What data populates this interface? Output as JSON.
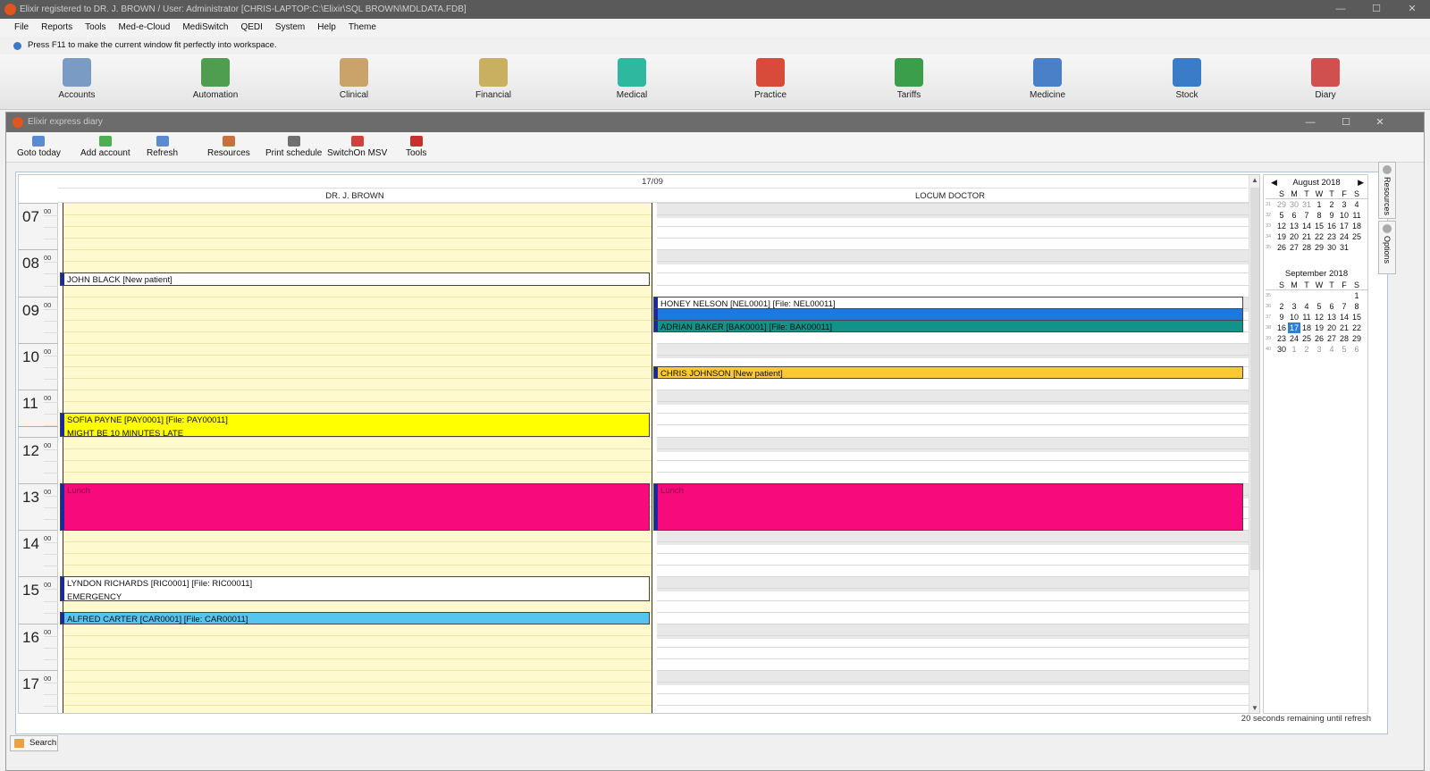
{
  "window": {
    "title": "Elixir registered to DR. J. BROWN / User: Administrator [CHRIS-LAPTOP:C:\\Elixir\\SQL BROWN\\MDLDATA.FDB]",
    "minimize": "—",
    "maximize": "☐",
    "close": "✕"
  },
  "menu": [
    "File",
    "Reports",
    "Tools",
    "Med-e-Cloud",
    "MediSwitch",
    "QEDI",
    "System",
    "Help",
    "Theme"
  ],
  "hint": "Press F11 to make the current window fit perfectly into workspace.",
  "modules": [
    {
      "label": "Accounts",
      "icon": "accounts-icon",
      "color": "#7a9cc4"
    },
    {
      "label": "Automation",
      "icon": "automation-icon",
      "color": "#4f9e4f"
    },
    {
      "label": "Clinical",
      "icon": "clinical-icon",
      "color": "#c9a36a"
    },
    {
      "label": "Financial",
      "icon": "financial-icon",
      "color": "#c9b060"
    },
    {
      "label": "Medical",
      "icon": "medical-icon",
      "color": "#2fb8a0"
    },
    {
      "label": "Practice",
      "icon": "practice-icon",
      "color": "#d84a3a"
    },
    {
      "label": "Tariffs",
      "icon": "tariffs-icon",
      "color": "#3a9e4a"
    },
    {
      "label": "Medicine",
      "icon": "medicine-icon",
      "color": "#4a80c8"
    },
    {
      "label": "Stock",
      "icon": "stock-icon",
      "color": "#3a7cc8"
    },
    {
      "label": "Diary",
      "icon": "diary-icon",
      "color": "#d05050"
    }
  ],
  "diary": {
    "title": "Elixir express diary",
    "toolbar": [
      {
        "label": "Goto today",
        "icon": "calendar-icon",
        "color": "#5a8ad0"
      },
      {
        "label": "Add account",
        "icon": "add-icon",
        "color": "#4caf50"
      },
      {
        "label": "Refresh",
        "icon": "refresh-icon",
        "color": "#5a8ad0"
      },
      {
        "label": "Resources",
        "icon": "resources-icon",
        "color": "#c87040"
      },
      {
        "label": "Print schedule",
        "icon": "printer-icon",
        "color": "#707070"
      },
      {
        "label": "SwitchOn MSV",
        "icon": "switch-icon",
        "color": "#d04040"
      },
      {
        "label": "Tools",
        "icon": "toolbox-icon",
        "color": "#c83030"
      }
    ],
    "date": "17/09",
    "columns": [
      "DR. J. BROWN",
      "LOCUM DOCTOR"
    ],
    "hours": [
      "07",
      "08",
      "09",
      "10",
      "11",
      "12",
      "13",
      "14",
      "15",
      "16",
      "17"
    ],
    "minutes_label": "00",
    "appointments_col1": [
      {
        "text": "JOHN BLACK [New patient]",
        "note": "",
        "start": "08:30",
        "end": "08:45",
        "color": "#ffffff"
      },
      {
        "text": "SOFIA PAYNE [PAY0001] [File: PAY00011]",
        "note": "MIGHT BE 10 MINUTES LATE",
        "start": "11:30",
        "end": "12:00",
        "color": "#ffff00"
      },
      {
        "text": "Lunch",
        "note": "",
        "start": "13:00",
        "end": "14:00",
        "color": "#f70b7c"
      },
      {
        "text": "LYNDON RICHARDS [RIC0001] [File: RIC00011]",
        "note": "EMERGENCY",
        "start": "15:00",
        "end": "15:30",
        "color": "#ffffff"
      },
      {
        "text": "ALFRED CARTER [CAR0001] [File: CAR00011]",
        "note": "",
        "start": "15:45",
        "end": "16:00",
        "color": "#58c4f0"
      }
    ],
    "appointments_col2": [
      {
        "text": "HONEY NELSON [NEL0001] [File: NEL00011]",
        "note": "",
        "start": "09:00",
        "end": "09:15",
        "color": "#ffffff"
      },
      {
        "text": "",
        "note": "",
        "start": "09:15",
        "end": "09:30",
        "color": "#1e78e0"
      },
      {
        "text": "ADRIAN BAKER [BAK0001] [File: BAK00011]",
        "note": "",
        "start": "09:30",
        "end": "09:45",
        "color": "#11938a"
      },
      {
        "text": "CHRIS JOHNSON [New patient]",
        "note": "",
        "start": "10:30",
        "end": "10:45",
        "color": "#fcc838"
      },
      {
        "text": "Lunch",
        "note": "",
        "start": "13:00",
        "end": "14:00",
        "color": "#f70b7c"
      }
    ],
    "refresh_msg": "20 seconds remaining until refresh",
    "side_tabs": [
      "Resources",
      "Options"
    ],
    "search": "Search"
  },
  "calendars": [
    {
      "month": "August 2018",
      "days_header": [
        "S",
        "M",
        "T",
        "W",
        "T",
        "F",
        "S"
      ],
      "weeks": [
        {
          "wk": "31",
          "days": [
            "29",
            "30",
            "31",
            "1",
            "2",
            "3",
            "4"
          ],
          "dim": [
            0,
            1,
            2
          ]
        },
        {
          "wk": "32",
          "days": [
            "5",
            "6",
            "7",
            "8",
            "9",
            "10",
            "11"
          ],
          "dim": []
        },
        {
          "wk": "33",
          "days": [
            "12",
            "13",
            "14",
            "15",
            "16",
            "17",
            "18"
          ],
          "dim": []
        },
        {
          "wk": "34",
          "days": [
            "19",
            "20",
            "21",
            "22",
            "23",
            "24",
            "25"
          ],
          "dim": []
        },
        {
          "wk": "35",
          "days": [
            "26",
            "27",
            "28",
            "29",
            "30",
            "31",
            ""
          ],
          "dim": []
        }
      ]
    },
    {
      "month": "September 2018",
      "days_header": [
        "S",
        "M",
        "T",
        "W",
        "T",
        "F",
        "S"
      ],
      "weeks": [
        {
          "wk": "35",
          "days": [
            "",
            "",
            "",
            "",
            "",
            "",
            "1"
          ],
          "dim": []
        },
        {
          "wk": "36",
          "days": [
            "2",
            "3",
            "4",
            "5",
            "6",
            "7",
            "8"
          ],
          "dim": []
        },
        {
          "wk": "37",
          "days": [
            "9",
            "10",
            "11",
            "12",
            "13",
            "14",
            "15"
          ],
          "dim": []
        },
        {
          "wk": "38",
          "days": [
            "16",
            "17",
            "18",
            "19",
            "20",
            "21",
            "22"
          ],
          "dim": [],
          "today": 1
        },
        {
          "wk": "39",
          "days": [
            "23",
            "24",
            "25",
            "26",
            "27",
            "28",
            "29"
          ],
          "dim": []
        },
        {
          "wk": "40",
          "days": [
            "30",
            "1",
            "2",
            "3",
            "4",
            "5",
            "6"
          ],
          "dim": [
            1,
            2,
            3,
            4,
            5,
            6
          ]
        }
      ]
    }
  ]
}
